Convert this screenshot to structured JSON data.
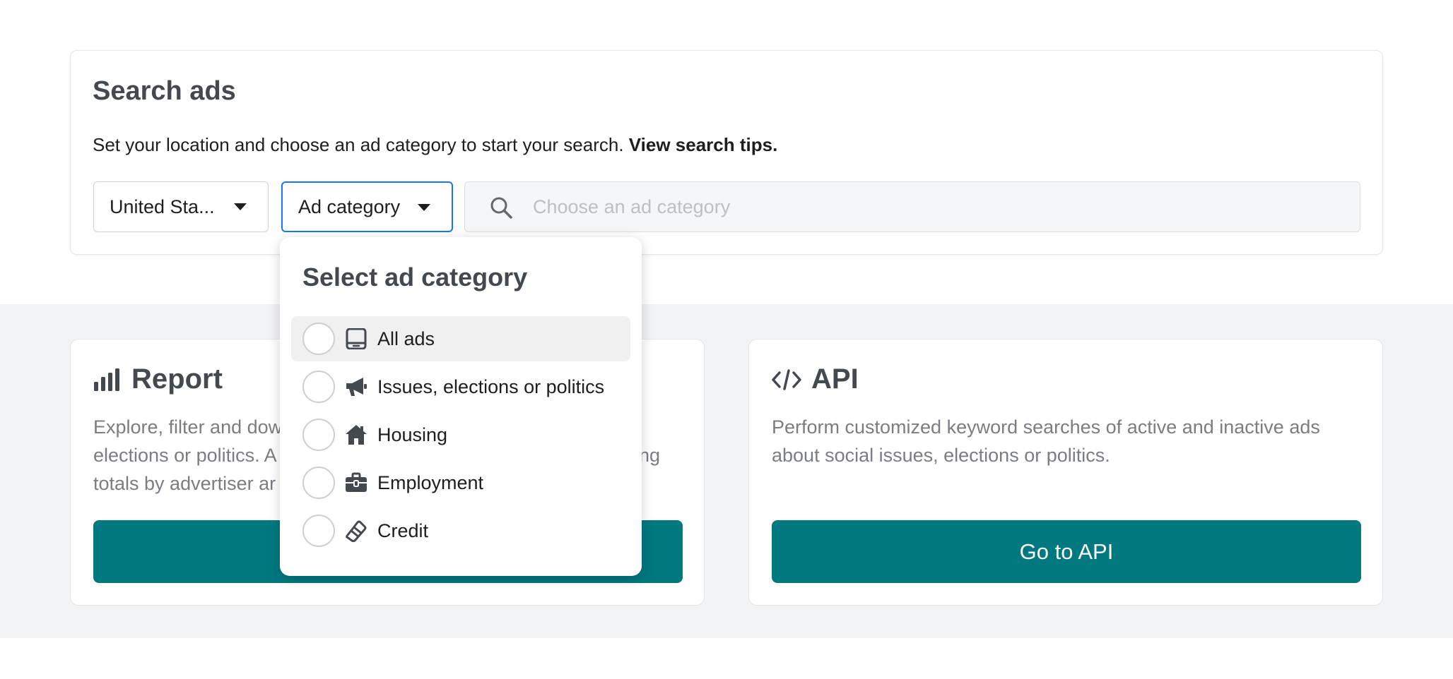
{
  "search": {
    "title": "Search ads",
    "description": "Set your location and choose an ad category to start your search.",
    "tips_link": "View search tips.",
    "country_value": "United Sta...",
    "category_value": "Ad category",
    "placeholder": "Choose an ad category"
  },
  "dropdown": {
    "title": "Select ad category",
    "options": [
      {
        "label": "All ads",
        "icon": "tablet-icon"
      },
      {
        "label": "Issues, elections or politics",
        "icon": "megaphone-icon"
      },
      {
        "label": "Housing",
        "icon": "house-icon"
      },
      {
        "label": "Employment",
        "icon": "briefcase-icon"
      },
      {
        "label": "Credit",
        "icon": "credit-card-icon"
      }
    ]
  },
  "report": {
    "title": "Report",
    "line1": "Explore, filter and dow",
    "line1_end": "",
    "line2": "elections or politics. A",
    "line2_end": "ng",
    "line3": "totals by advertiser ar",
    "icon": "bar-chart-icon"
  },
  "api": {
    "title": "API",
    "description": "Perform customized keyword searches of active and inactive ads about social issues, elections or politics.",
    "button": "Go to API",
    "icon": "code-icon"
  },
  "colors": {
    "accent": "#00787f",
    "focus": "#1877f2",
    "band": "#f2f3f5"
  }
}
